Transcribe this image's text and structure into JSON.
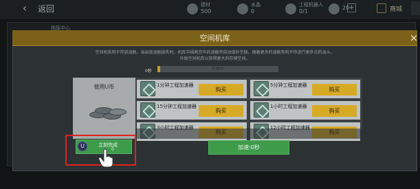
{
  "background": {
    "back_icon": "back-arrow-icon",
    "title": "返回",
    "center_label": "指挥中心",
    "resources": [
      {
        "label": "建材",
        "value": "500"
      },
      {
        "label": "水晶",
        "value": "0"
      },
      {
        "label": "工程机器人",
        "value": "0/1"
      },
      {
        "label": "",
        "value": "20"
      }
    ],
    "plus_icon": "plus-icon",
    "shop_label": "商城"
  },
  "modal": {
    "title": "空间机库",
    "close_icon": "close-icon",
    "description_line1": "空间机库用于存放战舰，当出现战舰损失时，机库中损耗完毕的战舰将自动填补空缺。随着更多的战舰有利于你进行更多次的战斗。",
    "description_line2": "升级空间机库以获得更大的存储空间。",
    "progress": {
      "timer": "0秒",
      "label": "升级中",
      "fraction": 0.02
    },
    "coin_panel": {
      "title": "使用U币",
      "icon": "coin-stack-icon"
    },
    "items": [
      {
        "name": "1分钟工程加速器",
        "icon": "accelerator-icon",
        "buy_label": "购买"
      },
      {
        "name": "5分钟工程加速器",
        "icon": "accelerator-icon",
        "buy_label": "购买"
      },
      {
        "name": "15分钟工程加速器",
        "icon": "accelerator-icon",
        "buy_label": "购买"
      },
      {
        "name": "1小时工程加速器",
        "icon": "accelerator-icon",
        "buy_label": "购买"
      },
      {
        "name": "3小时工程加速器",
        "icon": "accelerator-icon",
        "buy_label": "购买"
      },
      {
        "name": "12小时工程加速器",
        "icon": "accelerator-icon",
        "buy_label": "购买"
      }
    ],
    "instant_complete": {
      "badge": "U",
      "label": "立刻完成",
      "cost": "0"
    },
    "speedup_button": "加速:0秒"
  },
  "colors": {
    "header": "#7b6218",
    "buy_button": "#d7aa26",
    "green_button": "#3d9b4a",
    "highlight": "#e3231b"
  }
}
